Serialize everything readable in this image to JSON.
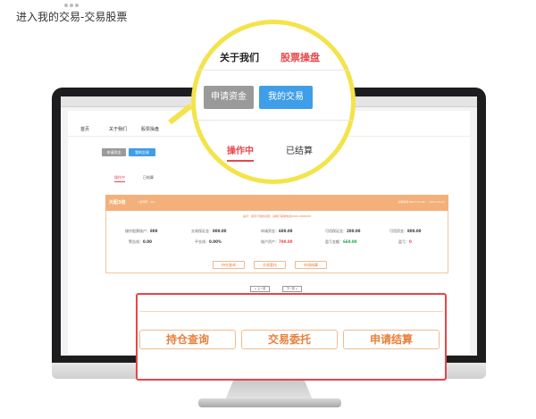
{
  "caption": "进入我的交易-交易股票",
  "site": {
    "nav": [
      "首页",
      "关于我们",
      "股票操盘"
    ],
    "buttons": {
      "apply_funds": "申请资金",
      "my_trades": "我的交易"
    },
    "tabs": {
      "active": "操作中",
      "settled": "已结算"
    },
    "panel": {
      "title": "天配3倍",
      "subtitle": "( 合同号：12 )",
      "right_info": "交易时间 2017-11-02 — 2017-11-07",
      "note": "提示：如有不懂的问题，请拨打客服电话0000-0000000",
      "rows": [
        [
          {
            "label": "操作股票账户：",
            "value": "800"
          },
          {
            "label": "交易保证金：",
            "value": "800.00"
          },
          {
            "label": "申请资金：",
            "value": "600.00"
          },
          {
            "label": "可用保证金：",
            "value": "200.00"
          },
          {
            "label": "可用资金：",
            "value": "800.00"
          }
        ],
        [
          {
            "label": "警告线：",
            "value": "0.00"
          },
          {
            "label": "平仓线：",
            "value": "0.00%"
          },
          {
            "label": "账户资产：",
            "value": "790.00"
          },
          {
            "label": "盈亏金额：",
            "value": "660.00"
          },
          {
            "label": "盈亏：",
            "value": "0"
          }
        ]
      ],
      "actions": [
        "持仓查询",
        "交易委托",
        "申请结算"
      ]
    },
    "pager": {
      "prev": "< 上一页",
      "next": "下一页 >"
    }
  },
  "zoom_circle": {
    "nav": {
      "about": "关于我们",
      "stocks": "股票操盘"
    },
    "buttons": {
      "apply_funds": "申请资金",
      "my_trades": "我的交易"
    },
    "tabs": {
      "active": "操作中",
      "settled": "已结算"
    }
  },
  "zoom_box": {
    "actions": [
      "持仓查询",
      "交易委托",
      "申请结算"
    ]
  },
  "colors": {
    "accent_red": "#e8474c",
    "blue": "#3f9ee8",
    "orange": "#f4b07a",
    "yellow_ring": "#f4e34a"
  }
}
